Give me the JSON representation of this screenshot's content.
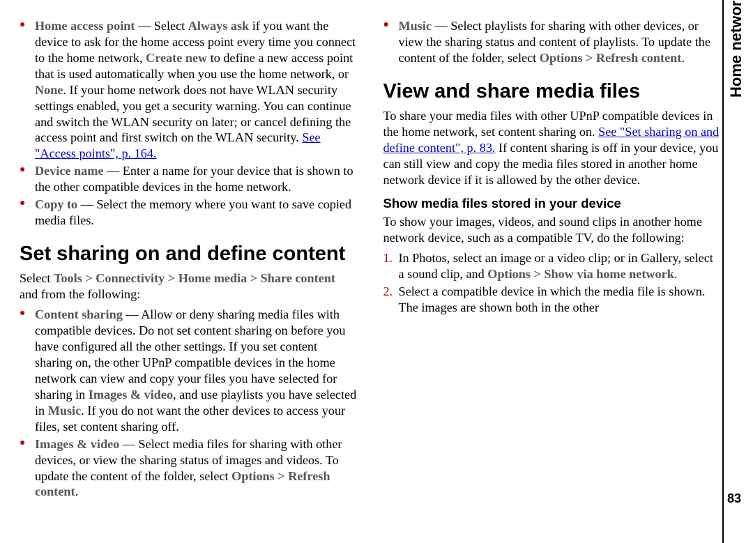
{
  "side_label": "Home network",
  "page_number": "83",
  "col1": {
    "bullets": [
      {
        "term": "Home access point",
        "t1": " — Select ",
        "opt1": "Always ask",
        "t2": " if you want the device to ask for the home access point every time you connect to the home network, ",
        "opt2": "Create new",
        "t3": " to define a new access point that is used automatically when you use the home network, or ",
        "opt3": "None",
        "t4": ". If your home network does not have WLAN security settings enabled, you get a security warning. You can continue and switch the WLAN security on later; or cancel defining the access point and first switch on the WLAN security. ",
        "link": "See \"Access points\", p. 164."
      },
      {
        "term": "Device name",
        "t1": " — Enter a name for your device that is shown to the other compatible devices in the home network."
      },
      {
        "term": "Copy to",
        "t1": " — Select the memory where you want to save copied media files."
      }
    ],
    "h2": "Set sharing on and define content",
    "lead_pre": "Select ",
    "lead_path": "Tools > Connectivity > Home media > Share content",
    "lead_post": " and from the following:",
    "bullets2": [
      {
        "term": "Content sharing",
        "t1": " — Allow or deny sharing media files with compatible devices. Do not set content sharing on before you have configured all the other settings. If you set content sharing on, the other UPnP compatible devices in the home network can view and copy your files you have selected for sharing in ",
        "em1": "Images & video",
        "t2": ", and use playlists you have selected in ",
        "em2": "Music",
        "t3": ". If you do not want the other devices to access your files, set content sharing off."
      },
      {
        "term": "Images & video",
        "t1": " — Select media files for sharing with other devices, or view the sharing status of images and videos. To update the content of the folder, select ",
        "em1": "Options > Refresh content",
        "t2": "."
      },
      {
        "term": "Music",
        "t1": " — Select playlists for sharing with other devices, or view the sharing status and content of playlists. To update the content of the folder, select ",
        "em1": "Options > Refresh content",
        "t2": "."
      }
    ]
  },
  "col2": {
    "h2": "View and share media files",
    "p1a": "To share your media files with other UPnP compatible devices in the home network, set content sharing on. ",
    "p1_link": "See \"Set sharing on and define content\", p. 83.",
    "p1b": " If content sharing is off in your device, you can still view and copy the media files stored in another home network device if it is allowed by the other device.",
    "sub": "Show media files stored in your device",
    "p2": "To show your images, videos, and sound clips in another home network device, such as a compatible TV, do the following:",
    "steps": [
      {
        "t1": "In Photos, select an image or a video clip; or in Gallery, select a sound clip, and ",
        "em1": "Options > Show via home network",
        "t2": "."
      },
      {
        "t1": "Select a compatible device in which the media file is shown. The images are shown both in the other"
      }
    ]
  }
}
